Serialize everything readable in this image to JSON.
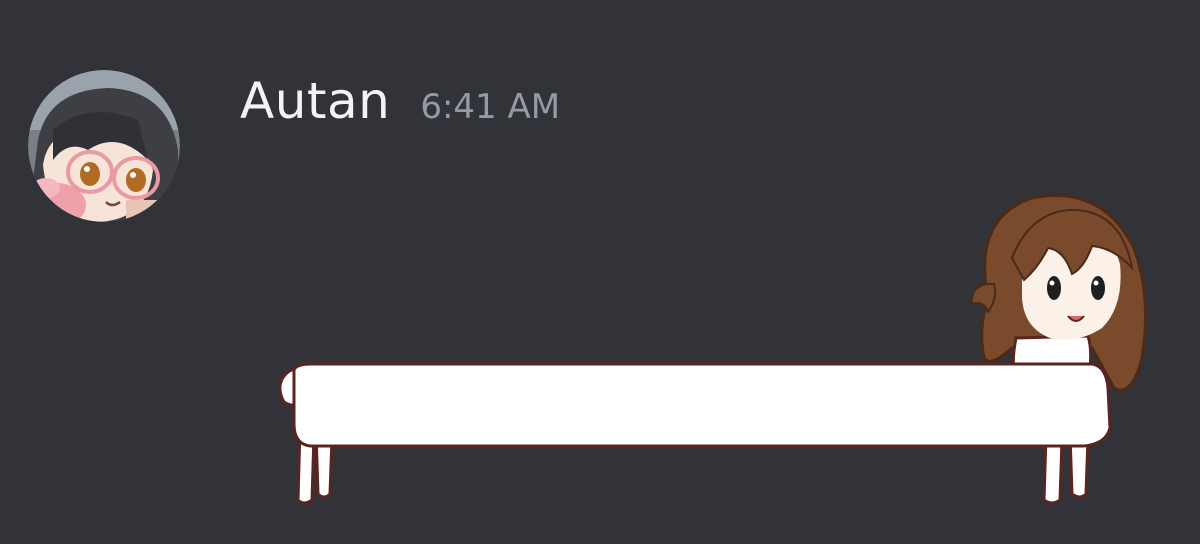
{
  "message": {
    "author": "Autan",
    "timestamp": "6:41 AM"
  },
  "colors": {
    "background": "#313338",
    "username": "#f2f3f5",
    "timestamp": "#949ba4"
  },
  "icons": {
    "avatar": "anime-avatar-with-glasses",
    "attachment": "long-neck-llama-girl-sticker"
  }
}
